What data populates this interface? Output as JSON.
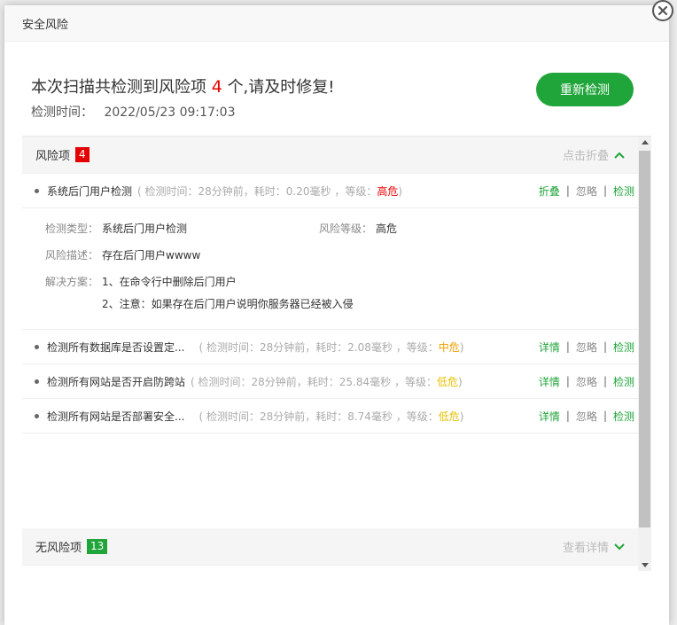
{
  "dialog": {
    "title": "安全风险",
    "summary_prefix": "本次扫描共检测到风险项",
    "risk_count": "4",
    "summary_suffix": "个,请及时修复!",
    "scan_time_label": "检测时间：",
    "scan_time": "2022/05/23 09:17:03",
    "rescan_button": "重新检测"
  },
  "risk_section": {
    "label": "风险项",
    "count": "4",
    "collapse_label": "点击折叠",
    "items": [
      {
        "name": "系统后门用户检测",
        "meta_prefix": "( 检测时间：28分钟前，耗时：0.20毫秒 ，等级：",
        "level": "高危",
        "meta_suffix": ")",
        "action_primary": "折叠",
        "action_ignore": "忽略",
        "action_check": "检测"
      },
      {
        "name": "检测所有数据库是否设置定...",
        "meta_prefix": "( 检测时间：28分钟前，耗时：2.08毫秒 ，等级：",
        "level": "中危",
        "meta_suffix": ")",
        "action_primary": "详情",
        "action_ignore": "忽略",
        "action_check": "检测"
      },
      {
        "name": "检测所有网站是否开启防跨站",
        "meta_prefix": "( 检测时间：28分钟前，耗时：25.84毫秒 ，等级：",
        "level": "低危",
        "meta_suffix": ")",
        "action_primary": "详情",
        "action_ignore": "忽略",
        "action_check": "检测"
      },
      {
        "name": "检测所有网站是否部署安全...",
        "meta_prefix": "( 检测时间：28分钟前，耗时：8.74毫秒 ，等级：",
        "level": "低危",
        "meta_suffix": ")",
        "action_primary": "详情",
        "action_ignore": "忽略",
        "action_check": "检测"
      }
    ],
    "detail": {
      "type_label": "检测类型：",
      "type_value": "系统后门用户检测",
      "level_label": "风险等级：",
      "level_value": "高危",
      "desc_label": "风险描述：",
      "desc_value": "存在后门用户wwww",
      "solution_label": "解决方案：",
      "solution_1": "1、在命令行中删除后门用户",
      "solution_2": "2、注意：如果存在后门用户说明你服务器已经被入侵"
    }
  },
  "no_risk_section": {
    "label": "无风险项",
    "count": "13",
    "details_label": "查看详情"
  },
  "colors": {
    "accent": "#20a53a",
    "danger": "#e50000",
    "medium": "#f0a000",
    "low": "#e6c000"
  }
}
